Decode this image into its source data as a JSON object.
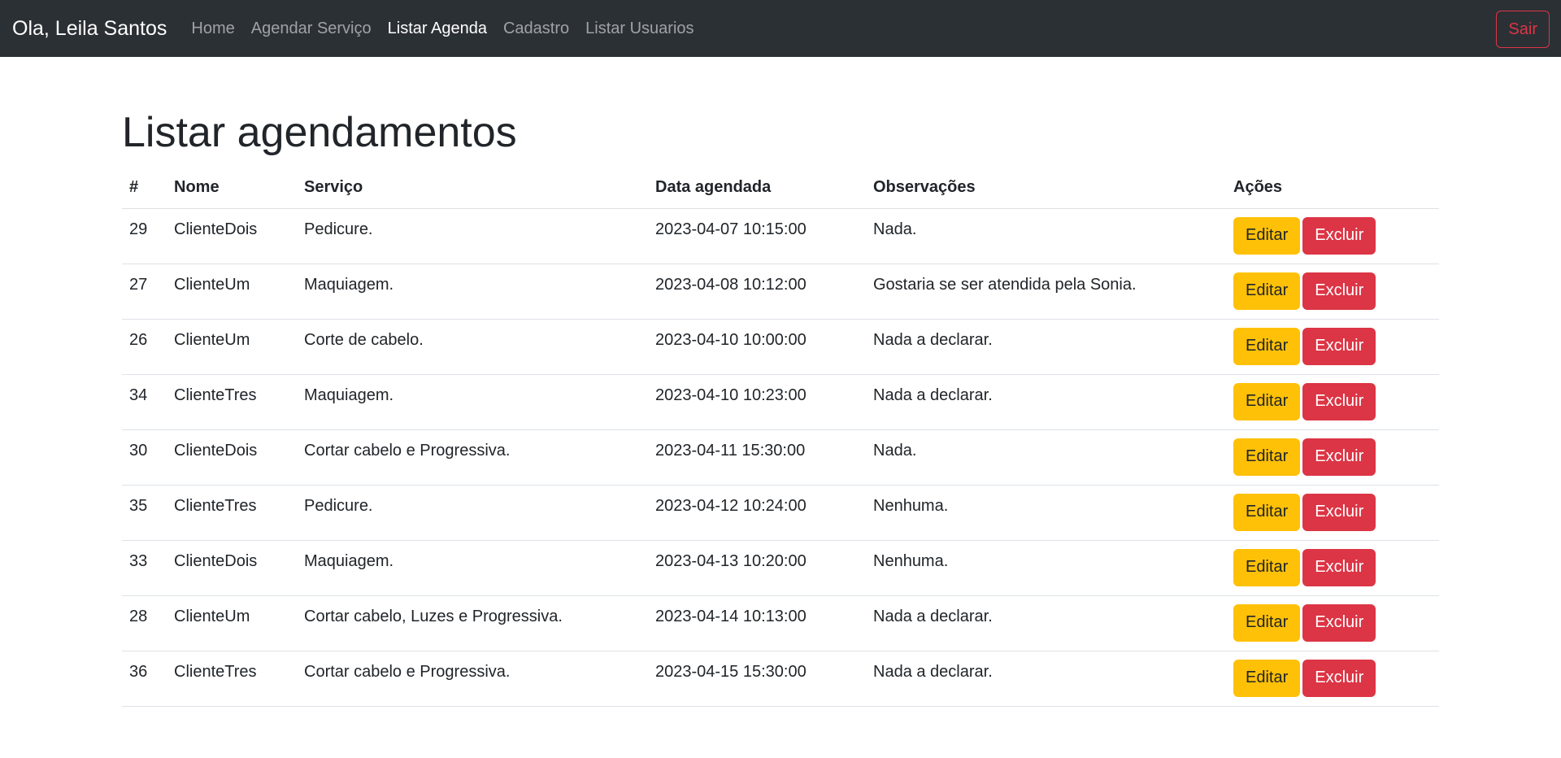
{
  "navbar": {
    "brand": "Ola, Leila Santos",
    "links": [
      {
        "label": "Home",
        "active": false
      },
      {
        "label": "Agendar Serviço",
        "active": false
      },
      {
        "label": "Listar Agenda",
        "active": true
      },
      {
        "label": "Cadastro",
        "active": false
      },
      {
        "label": "Listar Usuarios",
        "active": false
      }
    ],
    "logout_label": "Sair"
  },
  "page": {
    "title": "Listar agendamentos"
  },
  "table": {
    "headers": [
      "#",
      "Nome",
      "Serviço",
      "Data agendada",
      "Observações",
      "Ações"
    ],
    "edit_label": "Editar",
    "delete_label": "Excluir",
    "rows": [
      {
        "id": "29",
        "nome": "ClienteDois",
        "servico": "Pedicure.",
        "data": "2023-04-07 10:15:00",
        "obs": "Nada."
      },
      {
        "id": "27",
        "nome": "ClienteUm",
        "servico": "Maquiagem.",
        "data": "2023-04-08 10:12:00",
        "obs": "Gostaria se ser atendida pela Sonia."
      },
      {
        "id": "26",
        "nome": "ClienteUm",
        "servico": "Corte de cabelo.",
        "data": "2023-04-10 10:00:00",
        "obs": "Nada a declarar."
      },
      {
        "id": "34",
        "nome": "ClienteTres",
        "servico": "Maquiagem.",
        "data": "2023-04-10 10:23:00",
        "obs": "Nada a declarar."
      },
      {
        "id": "30",
        "nome": "ClienteDois",
        "servico": "Cortar cabelo e Progressiva.",
        "data": "2023-04-11 15:30:00",
        "obs": "Nada."
      },
      {
        "id": "35",
        "nome": "ClienteTres",
        "servico": "Pedicure.",
        "data": "2023-04-12 10:24:00",
        "obs": "Nenhuma."
      },
      {
        "id": "33",
        "nome": "ClienteDois",
        "servico": "Maquiagem.",
        "data": "2023-04-13 10:20:00",
        "obs": "Nenhuma."
      },
      {
        "id": "28",
        "nome": "ClienteUm",
        "servico": "Cortar cabelo, Luzes e Progressiva.",
        "data": "2023-04-14 10:13:00",
        "obs": "Nada a declarar."
      },
      {
        "id": "36",
        "nome": "ClienteTres",
        "servico": "Cortar cabelo e Progressiva.",
        "data": "2023-04-15 15:30:00",
        "obs": "Nada a declarar."
      }
    ]
  },
  "colors": {
    "navbar_bg": "#2b3035",
    "warning": "#ffc107",
    "danger": "#dc3545"
  }
}
